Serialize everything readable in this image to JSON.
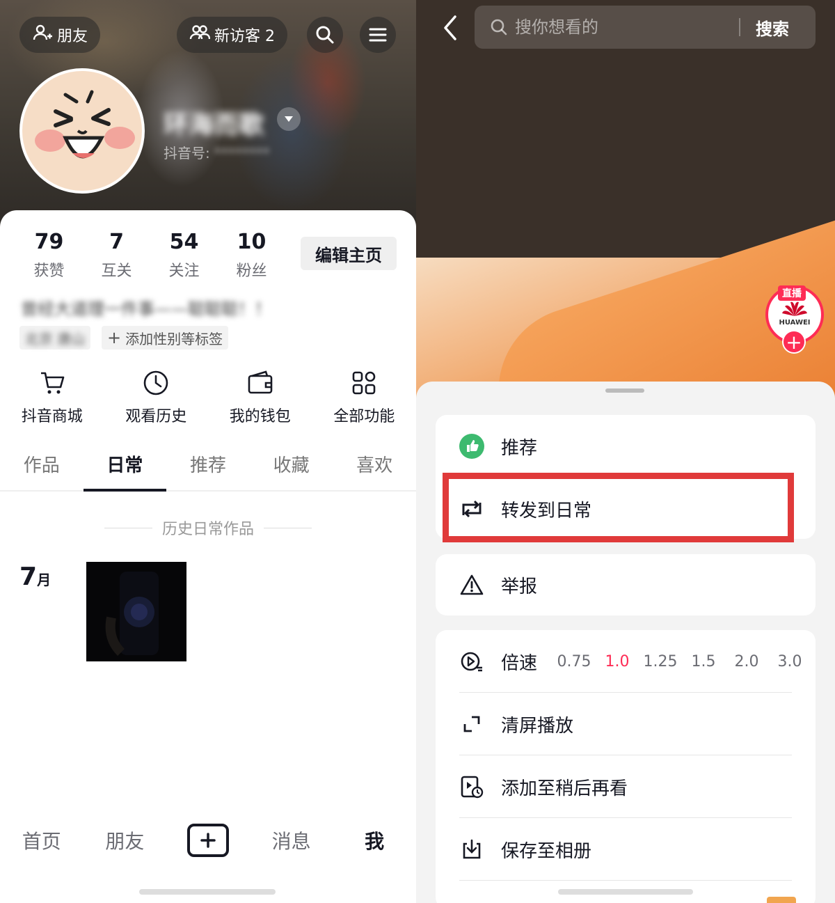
{
  "left": {
    "header": {
      "friends_label": "朋友",
      "visitors_label": "新访客 2"
    },
    "profile": {
      "nickname": "环海而歌",
      "douyin_id_label": "抖音号:",
      "douyin_id_value": "********"
    },
    "stats": [
      {
        "num": "79",
        "label": "获赞"
      },
      {
        "num": "7",
        "label": "互关"
      },
      {
        "num": "54",
        "label": "关注"
      },
      {
        "num": "10",
        "label": "粉丝"
      }
    ],
    "edit_profile_label": "编辑主页",
    "bio": "曾经大道理一件事——聪聪聪！！",
    "location_tag": "北京 唐山",
    "add_tag_label": "添加性别等标签",
    "tools": [
      {
        "label": "抖音商城",
        "icon": "cart-icon"
      },
      {
        "label": "观看历史",
        "icon": "clock-icon"
      },
      {
        "label": "我的钱包",
        "icon": "wallet-icon"
      },
      {
        "label": "全部功能",
        "icon": "grid-icon"
      }
    ],
    "tabs": [
      "作品",
      "日常",
      "推荐",
      "收藏",
      "喜欢"
    ],
    "active_tab": "日常",
    "history_label": "历史日常作品",
    "month_num": "7",
    "month_unit": "月",
    "bottom_nav": [
      "首页",
      "朋友",
      "消息",
      "我"
    ]
  },
  "right": {
    "search": {
      "placeholder": "搜你想看的",
      "button_label": "搜索"
    },
    "live": {
      "badge": "直播",
      "brand": "HUAWEI",
      "plus": "+"
    },
    "menu": {
      "recommend_label": "推荐",
      "repost_label": "转发到日常",
      "report_label": "举报",
      "speed_label": "倍速",
      "speeds": [
        "0.75",
        "1.0",
        "1.25",
        "1.5",
        "2.0",
        "3.0"
      ],
      "selected_speed": "1.0",
      "clear_screen_label": "清屏播放",
      "watch_later_label": "添加至稍后再看",
      "save_album_label": "保存至相册"
    },
    "colors": {
      "accent": "#fe2c55",
      "recommend_green": "#3dba6f",
      "highlight_red": "#e03a3a"
    }
  }
}
